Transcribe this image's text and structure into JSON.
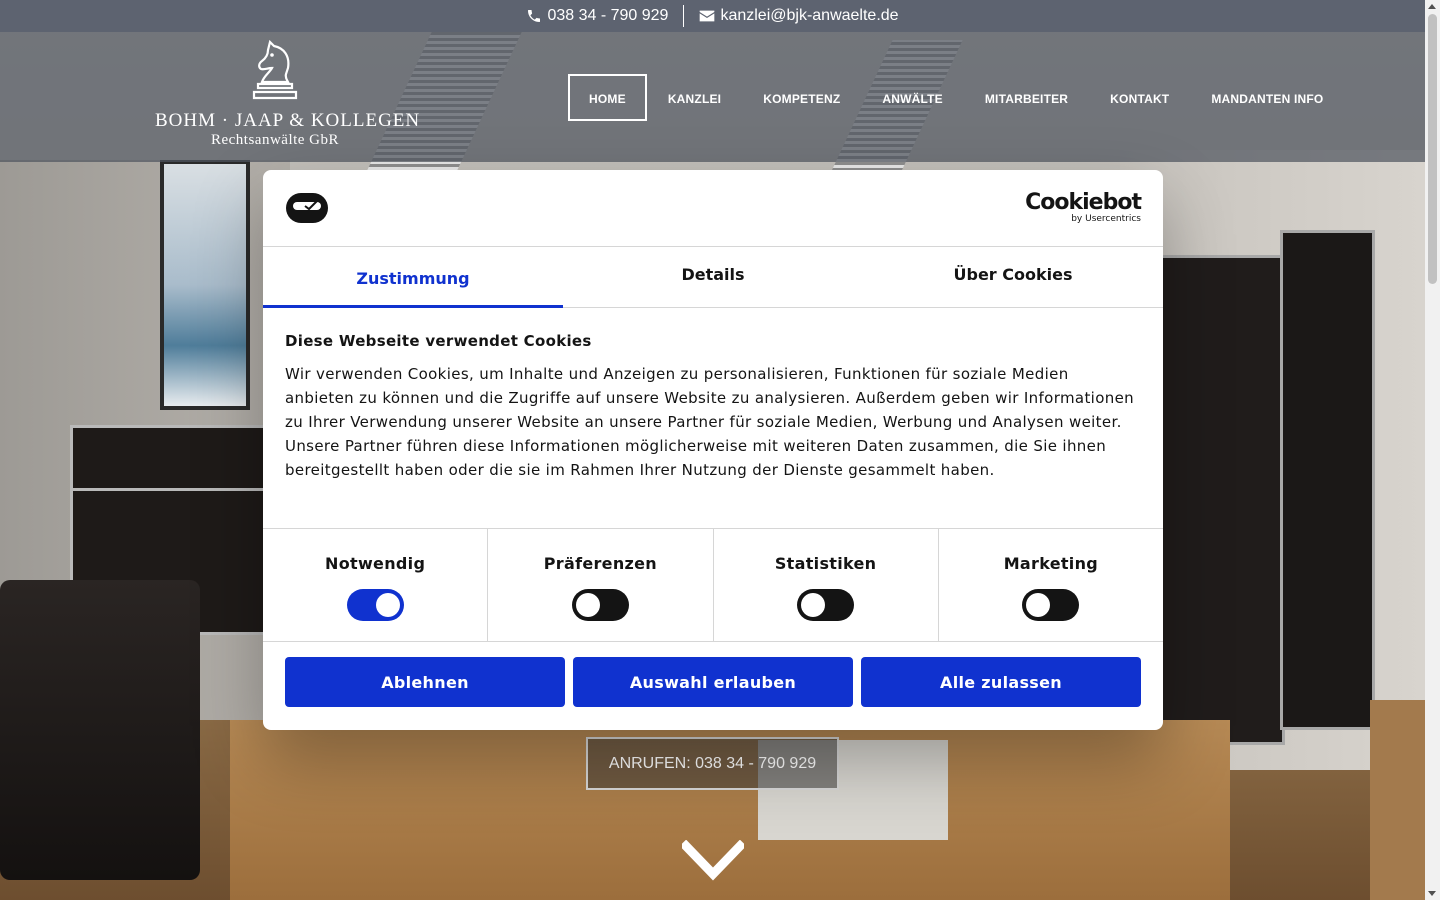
{
  "topbar": {
    "phone": "038 34 - 790 929",
    "email": "kanzlei@bjk-anwaelte.de"
  },
  "logo": {
    "firm": "BOHM · JAAP & KOLLEGEN",
    "subtitle": "Rechtsanwälte GbR"
  },
  "nav": {
    "items": [
      {
        "label": "HOME",
        "active": true
      },
      {
        "label": "KANZLEI"
      },
      {
        "label": "KOMPETENZ"
      },
      {
        "label": "ANWÄLTE"
      },
      {
        "label": "MITARBEITER"
      },
      {
        "label": "KONTAKT"
      },
      {
        "label": "MANDANTEN INFO"
      }
    ]
  },
  "hero": {
    "call_button": "ANRUFEN: 038 34 - 790 929",
    "scroll_icon": "chevron-down-icon"
  },
  "cookie": {
    "brand": "Cookiebot",
    "brand_by": "by Usercentrics",
    "tabs": [
      "Zustimmung",
      "Details",
      "Über Cookies"
    ],
    "active_tab": "Zustimmung",
    "heading": "Diese Webseite verwendet Cookies",
    "text": "Wir verwenden Cookies, um Inhalte und Anzeigen zu personalisieren, Funktionen für soziale Medien anbieten zu können und die Zugriffe auf unsere Website zu analysieren. Außerdem geben wir Informationen zu Ihrer Verwendung unserer Website an unsere Partner für soziale Medien, Werbung und Analysen weiter. Unsere Partner führen diese Informationen möglicherweise mit weiteren Daten zusammen, die Sie ihnen bereitgestellt haben oder die sie im Rahmen Ihrer Nutzung der Dienste gesammelt haben.",
    "categories": [
      {
        "label": "Notwendig",
        "checked": true
      },
      {
        "label": "Präferenzen",
        "checked": false
      },
      {
        "label": "Statistiken",
        "checked": false
      },
      {
        "label": "Marketing",
        "checked": false
      }
    ],
    "buttons": {
      "deny": "Ablehnen",
      "allow_selection": "Auswahl erlauben",
      "allow_all": "Alle zulassen"
    },
    "accent_color": "#1032cf"
  }
}
